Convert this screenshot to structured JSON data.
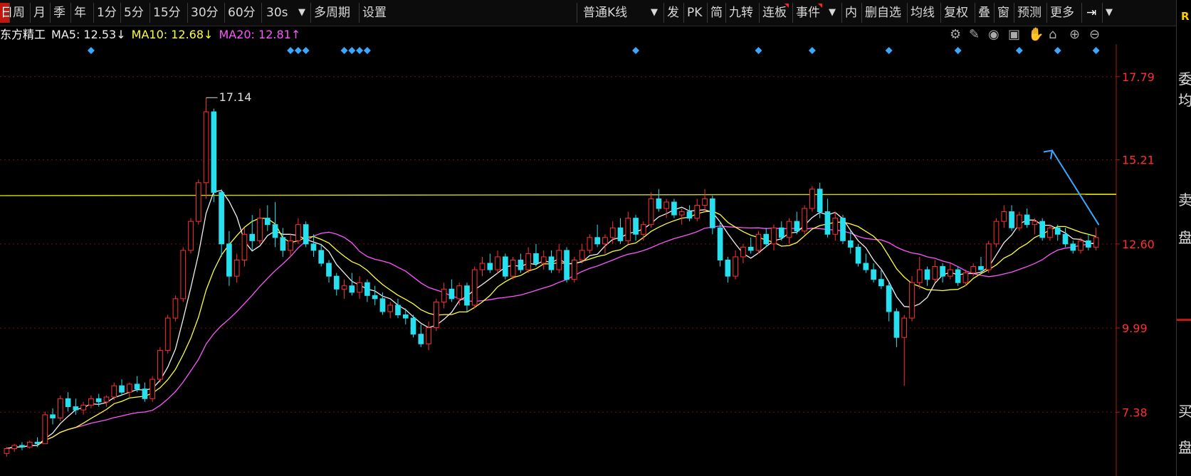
{
  "toolbar": {
    "periods": [
      "周",
      "月",
      "季",
      "年",
      "1分",
      "5分",
      "15分",
      "30分",
      "60分",
      "30s"
    ],
    "active_marker": "日",
    "multi_period": "多周期",
    "settings": "设置",
    "kline_type": "普通K线",
    "right_items": [
      "发",
      "PK",
      "简",
      "九转",
      "连板",
      "事件",
      "内",
      "删自选",
      "均线",
      "复权",
      "叠",
      "窗",
      "预测",
      "更多"
    ],
    "flagged_items": [
      "连板",
      "事件"
    ]
  },
  "stock": {
    "name": "东方精工",
    "ma5": "MA5: 12.53↓",
    "ma10": "MA10: 12.68↓",
    "ma20": "MA20: 12.81↑"
  },
  "tool_icons": [
    "settings-icon",
    "brush-icon",
    "eye-icon",
    "lock-toggle-icon",
    "hand-icon",
    "lock-icon",
    "zoom-in-icon",
    "zoom-out-icon"
  ],
  "right_panel": {
    "badge": "R",
    "labels": [
      "委",
      "均",
      "卖",
      "盘",
      "买",
      "盘"
    ]
  },
  "colors": {
    "up": "#ff3030",
    "down": "#26e0f0",
    "ma5": "#f0f0f0",
    "ma10": "#ffff3a",
    "ma20": "#ff55ff",
    "resistance": "#d8d800",
    "arrow": "#3aa8ff",
    "grid": "#7a1010",
    "marker": "#3aa8ff"
  },
  "chart_data": {
    "type": "candlestick",
    "y_axis": {
      "ticks": [
        17.79,
        15.21,
        12.6,
        9.99,
        7.38
      ],
      "min": 5.4,
      "max": 18.8
    },
    "peak_label": "17.14",
    "resistance_level": 14.1,
    "ohlc_count": 143,
    "candles": [
      [
        6.1,
        6.3,
        6.0,
        6.25
      ],
      [
        6.25,
        6.4,
        6.15,
        6.35
      ],
      [
        6.35,
        6.45,
        6.2,
        6.3
      ],
      [
        6.3,
        6.5,
        6.25,
        6.45
      ],
      [
        6.45,
        6.6,
        6.3,
        6.4
      ],
      [
        6.4,
        7.4,
        6.4,
        7.3
      ],
      [
        7.3,
        7.5,
        7.0,
        7.2
      ],
      [
        7.2,
        7.9,
        7.1,
        7.8
      ],
      [
        7.8,
        8.0,
        7.4,
        7.55
      ],
      [
        7.55,
        7.8,
        7.3,
        7.45
      ],
      [
        7.45,
        7.7,
        7.3,
        7.6
      ],
      [
        7.6,
        7.9,
        7.5,
        7.8
      ],
      [
        7.8,
        7.95,
        7.55,
        7.7
      ],
      [
        7.7,
        7.9,
        7.55,
        7.85
      ],
      [
        7.85,
        8.3,
        7.75,
        8.2
      ],
      [
        8.2,
        8.4,
        7.9,
        8.0
      ],
      [
        8.0,
        8.3,
        7.85,
        8.25
      ],
      [
        8.25,
        8.5,
        8.0,
        8.1
      ],
      [
        8.1,
        8.3,
        7.7,
        7.8
      ],
      [
        7.8,
        8.5,
        7.7,
        8.4
      ],
      [
        8.4,
        9.4,
        8.3,
        9.3
      ],
      [
        9.3,
        10.4,
        9.2,
        10.3
      ],
      [
        10.3,
        11.0,
        10.2,
        10.9
      ],
      [
        10.9,
        12.5,
        10.8,
        12.4
      ],
      [
        12.4,
        13.4,
        12.3,
        13.3
      ],
      [
        13.3,
        14.6,
        13.2,
        14.5
      ],
      [
        14.5,
        17.14,
        14.0,
        16.7
      ],
      [
        16.7,
        16.8,
        13.9,
        14.2
      ],
      [
        14.2,
        14.3,
        12.2,
        12.6
      ],
      [
        12.6,
        13.0,
        11.3,
        11.6
      ],
      [
        11.6,
        12.3,
        11.4,
        12.1
      ],
      [
        12.1,
        13.1,
        11.9,
        12.9
      ],
      [
        12.9,
        13.5,
        12.4,
        12.7
      ],
      [
        12.7,
        13.7,
        12.6,
        13.4
      ],
      [
        13.4,
        13.8,
        13.0,
        13.2
      ],
      [
        13.2,
        13.9,
        12.5,
        12.8
      ],
      [
        12.8,
        13.1,
        12.2,
        12.4
      ],
      [
        12.4,
        12.9,
        12.2,
        12.7
      ],
      [
        12.7,
        13.4,
        12.6,
        13.2
      ],
      [
        13.2,
        13.3,
        12.5,
        12.6
      ],
      [
        12.6,
        12.9,
        12.2,
        12.4
      ],
      [
        12.4,
        12.6,
        11.9,
        12.0
      ],
      [
        12.0,
        12.1,
        11.4,
        11.6
      ],
      [
        11.6,
        11.7,
        11.0,
        11.2
      ],
      [
        11.2,
        11.5,
        10.9,
        11.3
      ],
      [
        11.3,
        11.7,
        11.0,
        11.1
      ],
      [
        11.1,
        11.6,
        10.9,
        11.4
      ],
      [
        11.4,
        11.5,
        10.8,
        11.0
      ],
      [
        11.0,
        11.3,
        10.7,
        10.9
      ],
      [
        10.9,
        11.1,
        10.4,
        10.5
      ],
      [
        10.5,
        10.8,
        10.3,
        10.7
      ],
      [
        10.7,
        10.9,
        10.3,
        10.4
      ],
      [
        10.4,
        10.6,
        10.1,
        10.3
      ],
      [
        10.3,
        10.4,
        9.7,
        9.8
      ],
      [
        9.8,
        10.1,
        9.4,
        9.5
      ],
      [
        9.5,
        10.2,
        9.3,
        10.0
      ],
      [
        10.0,
        10.9,
        9.9,
        10.8
      ],
      [
        10.8,
        11.4,
        10.6,
        11.2
      ],
      [
        11.2,
        11.5,
        10.8,
        10.9
      ],
      [
        10.9,
        11.4,
        10.7,
        11.3
      ],
      [
        11.3,
        11.4,
        10.5,
        10.7
      ],
      [
        10.7,
        11.9,
        10.6,
        11.8
      ],
      [
        11.8,
        12.2,
        11.6,
        12.0
      ],
      [
        12.0,
        12.3,
        11.7,
        11.8
      ],
      [
        11.8,
        12.4,
        11.7,
        12.2
      ],
      [
        12.2,
        12.3,
        11.5,
        11.6
      ],
      [
        11.6,
        12.2,
        11.5,
        12.1
      ],
      [
        12.1,
        12.3,
        11.7,
        11.8
      ],
      [
        11.8,
        12.5,
        11.7,
        12.3
      ],
      [
        12.3,
        12.6,
        11.9,
        12.0
      ],
      [
        12.0,
        12.4,
        11.8,
        12.2
      ],
      [
        12.2,
        12.4,
        11.7,
        11.8
      ],
      [
        11.8,
        12.6,
        11.7,
        12.4
      ],
      [
        12.4,
        12.5,
        11.4,
        11.5
      ],
      [
        11.5,
        12.2,
        11.4,
        12.1
      ],
      [
        12.1,
        12.6,
        12.0,
        12.4
      ],
      [
        12.4,
        12.9,
        12.3,
        12.8
      ],
      [
        12.8,
        13.2,
        12.5,
        12.6
      ],
      [
        12.6,
        12.9,
        12.3,
        12.8
      ],
      [
        12.8,
        13.3,
        12.6,
        13.1
      ],
      [
        13.1,
        13.4,
        12.6,
        12.7
      ],
      [
        12.7,
        13.6,
        12.6,
        13.4
      ],
      [
        13.4,
        13.5,
        12.7,
        12.9
      ],
      [
        12.9,
        13.3,
        12.7,
        13.2
      ],
      [
        13.2,
        14.2,
        13.1,
        14.0
      ],
      [
        14.0,
        14.3,
        13.6,
        13.7
      ],
      [
        13.7,
        14.0,
        13.4,
        13.9
      ],
      [
        13.9,
        14.0,
        13.4,
        13.5
      ],
      [
        13.5,
        13.7,
        13.2,
        13.6
      ],
      [
        13.6,
        13.8,
        13.3,
        13.4
      ],
      [
        13.4,
        14.0,
        13.3,
        13.8
      ],
      [
        13.8,
        14.3,
        13.6,
        14.0
      ],
      [
        14.0,
        14.1,
        12.9,
        13.1
      ],
      [
        13.1,
        13.3,
        11.9,
        12.1
      ],
      [
        12.1,
        12.2,
        11.4,
        11.6
      ],
      [
        11.6,
        12.4,
        11.5,
        12.2
      ],
      [
        12.2,
        12.6,
        12.0,
        12.5
      ],
      [
        12.5,
        12.8,
        12.3,
        12.4
      ],
      [
        12.4,
        13.0,
        12.3,
        12.9
      ],
      [
        12.9,
        13.1,
        12.5,
        12.6
      ],
      [
        12.6,
        13.2,
        12.4,
        13.1
      ],
      [
        13.1,
        13.3,
        12.7,
        12.8
      ],
      [
        12.8,
        13.4,
        12.6,
        13.3
      ],
      [
        13.3,
        13.6,
        12.9,
        13.0
      ],
      [
        13.0,
        13.8,
        12.9,
        13.7
      ],
      [
        13.7,
        14.4,
        13.6,
        14.3
      ],
      [
        14.3,
        14.5,
        13.4,
        13.6
      ],
      [
        13.6,
        14.0,
        12.8,
        12.9
      ],
      [
        12.9,
        13.6,
        12.7,
        13.4
      ],
      [
        13.4,
        13.5,
        12.6,
        12.7
      ],
      [
        12.7,
        13.0,
        12.3,
        12.5
      ],
      [
        12.5,
        12.6,
        11.9,
        12.0
      ],
      [
        12.0,
        12.3,
        11.7,
        11.8
      ],
      [
        11.8,
        12.0,
        11.4,
        11.5
      ],
      [
        11.5,
        11.8,
        11.2,
        11.3
      ],
      [
        11.3,
        11.4,
        10.2,
        10.5
      ],
      [
        10.5,
        10.6,
        9.4,
        9.7
      ],
      [
        9.7,
        10.4,
        8.2,
        10.3
      ],
      [
        10.3,
        11.6,
        10.2,
        11.4
      ],
      [
        11.4,
        12.2,
        11.2,
        11.8
      ],
      [
        11.8,
        11.9,
        11.3,
        11.5
      ],
      [
        11.5,
        12.1,
        11.4,
        11.9
      ],
      [
        11.9,
        12.0,
        11.4,
        11.6
      ],
      [
        11.6,
        12.0,
        11.5,
        11.8
      ],
      [
        11.8,
        11.9,
        11.3,
        11.4
      ],
      [
        11.4,
        11.8,
        11.3,
        11.7
      ],
      [
        11.7,
        12.0,
        11.6,
        11.9
      ],
      [
        11.9,
        12.2,
        11.7,
        11.8
      ],
      [
        11.8,
        12.7,
        11.7,
        12.6
      ],
      [
        12.6,
        13.4,
        12.5,
        13.3
      ],
      [
        13.3,
        13.8,
        13.1,
        13.6
      ],
      [
        13.6,
        13.8,
        13.0,
        13.1
      ],
      [
        13.1,
        13.6,
        13.0,
        13.5
      ],
      [
        13.5,
        13.7,
        13.1,
        13.2
      ],
      [
        13.2,
        13.4,
        12.9,
        13.3
      ],
      [
        13.3,
        13.4,
        12.7,
        12.8
      ],
      [
        12.8,
        13.2,
        12.7,
        13.1
      ],
      [
        13.1,
        13.2,
        12.7,
        12.9
      ],
      [
        12.9,
        13.1,
        12.5,
        12.6
      ],
      [
        12.6,
        12.7,
        12.3,
        12.4
      ],
      [
        12.4,
        12.8,
        12.3,
        12.7
      ],
      [
        12.7,
        12.9,
        12.4,
        12.5
      ],
      [
        12.5,
        13.1,
        12.4,
        12.8
      ]
    ],
    "marker_indices": [
      11,
      37,
      38,
      39,
      44,
      45,
      46,
      47,
      82,
      98,
      105,
      115,
      124,
      132,
      137,
      142,
      150,
      160
    ]
  }
}
